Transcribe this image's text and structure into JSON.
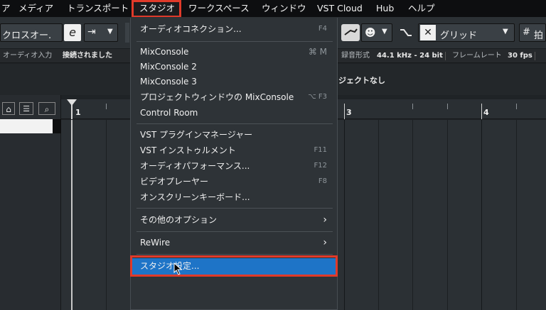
{
  "menubar": {
    "items": [
      "ア",
      "メディア",
      "トランスポート",
      "スタジオ",
      "ワークスペース",
      "ウィンドウ",
      "VST Cloud",
      "Hub",
      "ヘルプ"
    ]
  },
  "toolbar": {
    "crossfade_label": "クロスオー.",
    "edit_icon": "e",
    "snap_label": "グリッド",
    "grid_label": "拍"
  },
  "status": {
    "audio_input_label": "オーディオ入力",
    "connected": "接続されました",
    "record_format_label": "録音形式",
    "record_format": "44.1 kHz - 24 bit",
    "frame_rate_label": "フレームレート",
    "frame_rate": "30 fps"
  },
  "info": {
    "project_none": "ジェクトなし"
  },
  "ruler": {
    "marks": [
      "1",
      "3",
      "4"
    ]
  },
  "studio_menu": {
    "items": [
      {
        "label": "オーディオコネクション...",
        "shortcut": "F4"
      },
      {
        "label": "MixConsole",
        "shortcut": "⌘ M"
      },
      {
        "label": "MixConsole 2",
        "shortcut": ""
      },
      {
        "label": "MixConsole 3",
        "shortcut": ""
      },
      {
        "label": "プロジェクトウィンドウの MixConsole",
        "shortcut": "⌥ F3"
      },
      {
        "label": "Control Room",
        "shortcut": ""
      },
      {
        "label": "VST プラグインマネージャー",
        "shortcut": ""
      },
      {
        "label": "VST インストゥルメント",
        "shortcut": "F11"
      },
      {
        "label": "オーディオパフォーマンス...",
        "shortcut": "F12"
      },
      {
        "label": "ビデオプレーヤー",
        "shortcut": "F8"
      },
      {
        "label": "オンスクリーンキーボード...",
        "shortcut": ""
      },
      {
        "label": "その他のオプション",
        "shortcut": ""
      },
      {
        "label": "ReWire",
        "shortcut": ""
      },
      {
        "label": "スタジオ設定...",
        "shortcut": ""
      }
    ]
  },
  "colors": {
    "highlight": "#1e74c7",
    "annotation": "#e03a2a"
  }
}
